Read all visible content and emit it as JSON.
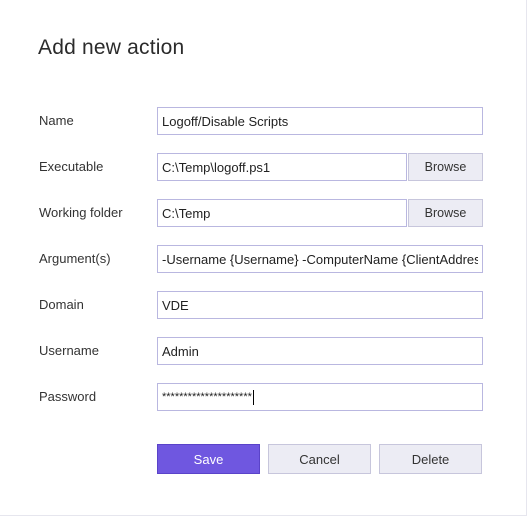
{
  "dialog": {
    "title": "Add new action"
  },
  "fields": {
    "name": {
      "label": "Name",
      "value": "Logoff/Disable Scripts"
    },
    "executable": {
      "label": "Executable",
      "value": "C:\\Temp\\logoff.ps1",
      "browse_label": "Browse"
    },
    "working_folder": {
      "label": "Working folder",
      "value": "C:\\Temp",
      "browse_label": "Browse"
    },
    "arguments": {
      "label": "Argument(s)",
      "value": "-Username {Username} -ComputerName {ClientAddress}"
    },
    "domain": {
      "label": "Domain",
      "value": "VDE"
    },
    "username": {
      "label": "Username",
      "value": "Admin"
    },
    "password": {
      "label": "Password",
      "value": "*********************"
    }
  },
  "buttons": {
    "save": "Save",
    "cancel": "Cancel",
    "delete": "Delete"
  },
  "colors": {
    "accent": "#6f57e0",
    "input_border": "#b9b7e0",
    "button_bg": "#ececf4"
  }
}
